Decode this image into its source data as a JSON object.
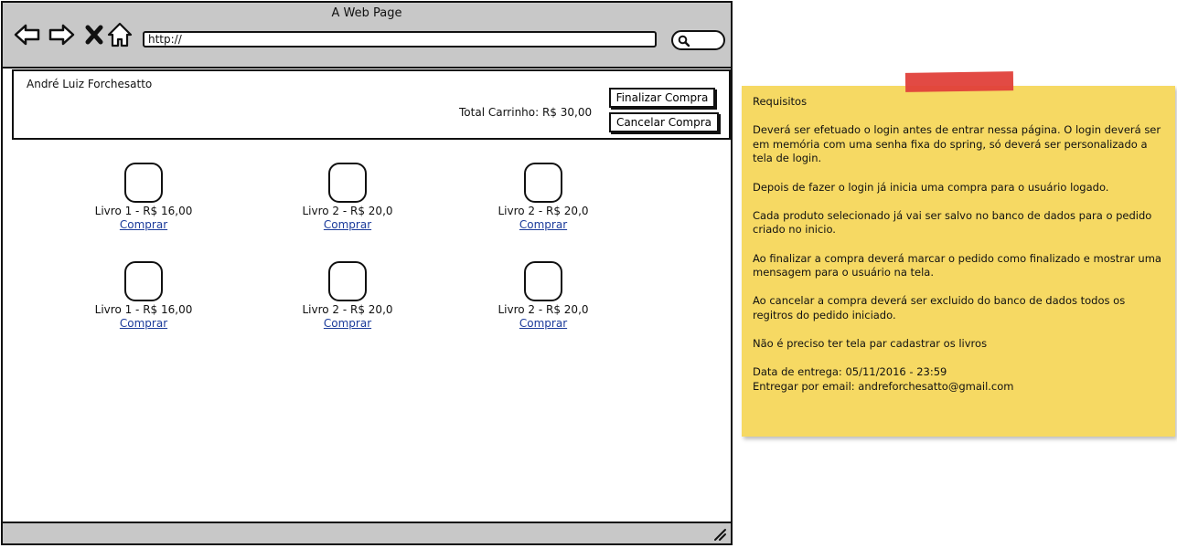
{
  "window": {
    "title": "A Web Page",
    "url": "http://",
    "nav_icons": [
      "back-arrow-icon",
      "forward-arrow-icon",
      "close-x-icon",
      "home-icon"
    ],
    "search_icon": "search-icon"
  },
  "header": {
    "user_name": "André Luiz Forchesatto",
    "cart_total": "Total Carrinho: R$ 30,00",
    "finalize_label": "Finalizar Compra",
    "cancel_label": "Cancelar Compra"
  },
  "products": [
    {
      "label": "Livro 1 - R$ 16,00",
      "link": "Comprar"
    },
    {
      "label": "Livro 2 - R$ 20,0",
      "link": "Comprar"
    },
    {
      "label": "Livro 2 - R$ 20,0",
      "link": "Comprar"
    },
    {
      "label": "Livro 1 - R$ 16,00",
      "link": "Comprar"
    },
    {
      "label": "Livro 2 - R$ 20,0",
      "link": "Comprar"
    },
    {
      "label": "Livro 2 - R$ 20,0",
      "link": "Comprar"
    }
  ],
  "note": {
    "title": "Requisitos",
    "paragraphs": [
      "Deverá ser efetuado o login antes de entrar nessa página. O login deverá ser em memória com uma senha fixa do spring, só deverá ser personalizado a tela de login.",
      "Depois de fazer o login já inicia uma compra para o usuário logado.",
      "Cada produto selecionado já vai ser salvo no banco de dados para o pedido criado no inicio.",
      "Ao finalizar a compra deverá marcar o pedido como finalizado e mostrar uma mensagem para o usuário na tela.",
      "Ao cancelar a compra deverá ser excluido do banco de dados todos os regitros do pedido iniciado.",
      "Não é preciso ter tela par cadastrar os livros"
    ],
    "delivery_date": "Data de entrega: 05/11/2016 - 23:59",
    "delivery_email": "Entregar por email: andreforchesatto@gmail.com"
  },
  "colors": {
    "chrome": "#c8c8c8",
    "note": "#f6d963",
    "tape": "#e0403a",
    "link": "#1a3a9a"
  }
}
